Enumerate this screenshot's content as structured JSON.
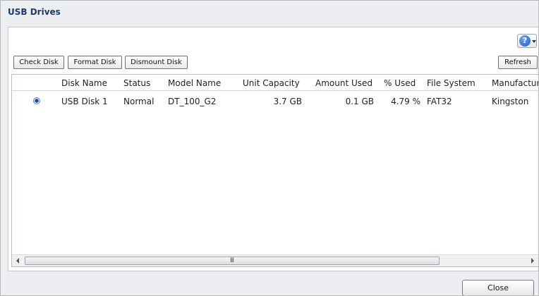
{
  "dialog": {
    "title": "USB Drives"
  },
  "toolbar": {
    "check_disk": "Check Disk",
    "format_disk": "Format Disk",
    "dismount_disk": "Dismount Disk",
    "refresh": "Refresh",
    "help_icon": "help-question-icon"
  },
  "table": {
    "columns": [
      "Disk Name",
      "Status",
      "Model Name",
      "Unit Capacity",
      "Amount Used",
      "% Used",
      "File System",
      "Manufacture"
    ],
    "rows": [
      {
        "selected": true,
        "disk_name": "USB Disk 1",
        "status": "Normal",
        "model_name": "DT_100_G2",
        "unit_capacity": "3.7 GB",
        "amount_used": "0.1 GB",
        "percent_used": "4.79 %",
        "file_system": "FAT32",
        "manufacturer": "Kingston"
      }
    ]
  },
  "scrollbar": {
    "grip": "III"
  },
  "footer": {
    "close": "Close"
  },
  "colors": {
    "title": "#1c3a6b",
    "panel_bg": "#eceef1",
    "help_blue": "#1d5bc1"
  }
}
